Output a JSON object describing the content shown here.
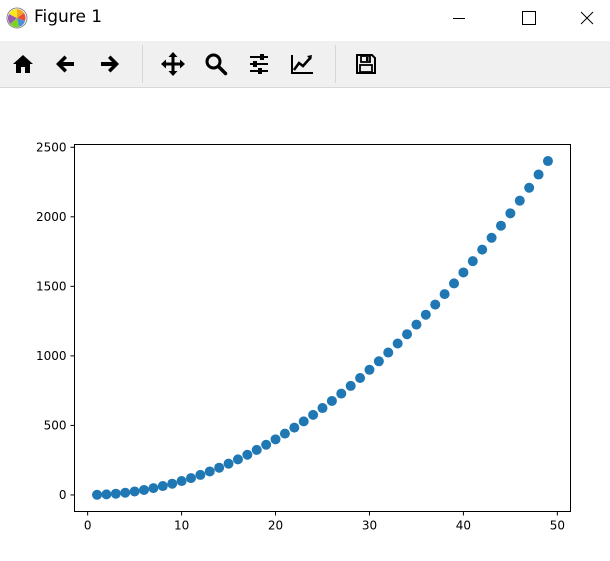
{
  "window": {
    "title": "Figure 1",
    "app_icon": "matplotlib-logo-icon",
    "controls": [
      "minimize-icon",
      "maximize-icon",
      "close-icon"
    ]
  },
  "toolbar": {
    "buttons": [
      {
        "name": "home",
        "icon": "home-icon"
      },
      {
        "name": "back",
        "icon": "arrow-left-icon"
      },
      {
        "name": "forward",
        "icon": "arrow-right-icon"
      },
      {
        "name": "pan",
        "icon": "move-icon"
      },
      {
        "name": "zoom",
        "icon": "magnifier-icon"
      },
      {
        "name": "subplots",
        "icon": "sliders-icon"
      },
      {
        "name": "edit-axis",
        "icon": "line-chart-icon"
      },
      {
        "name": "save",
        "icon": "floppy-disk-icon"
      }
    ]
  },
  "chart_data": {
    "type": "scatter",
    "title": "",
    "xlabel": "",
    "ylabel": "",
    "xlim": [
      -1.4,
      51.4
    ],
    "ylim": [
      -119,
      2520
    ],
    "xticks": [
      0,
      10,
      20,
      30,
      40,
      50
    ],
    "yticks": [
      0,
      500,
      1000,
      1500,
      2000,
      2500
    ],
    "xtick_labels": [
      "0",
      "10",
      "20",
      "30",
      "40",
      "50"
    ],
    "ytick_labels": [
      "0",
      "500",
      "1000",
      "1500",
      "2000",
      "2500"
    ],
    "color": "#1f77b4",
    "grid": false,
    "x": [
      1,
      2,
      3,
      4,
      5,
      6,
      7,
      8,
      9,
      10,
      11,
      12,
      13,
      14,
      15,
      16,
      17,
      18,
      19,
      20,
      21,
      22,
      23,
      24,
      25,
      26,
      27,
      28,
      29,
      30,
      31,
      32,
      33,
      34,
      35,
      36,
      37,
      38,
      39,
      40,
      41,
      42,
      43,
      44,
      45,
      46,
      47,
      48,
      49
    ],
    "y": [
      1,
      4,
      9,
      16,
      25,
      36,
      49,
      64,
      81,
      100,
      121,
      144,
      169,
      196,
      225,
      256,
      289,
      324,
      361,
      400,
      441,
      484,
      529,
      576,
      625,
      676,
      729,
      784,
      841,
      900,
      961,
      1024,
      1089,
      1156,
      1225,
      1296,
      1369,
      1444,
      1521,
      1600,
      1681,
      1764,
      1849,
      1936,
      2025,
      2116,
      2209,
      2304,
      2401
    ]
  }
}
